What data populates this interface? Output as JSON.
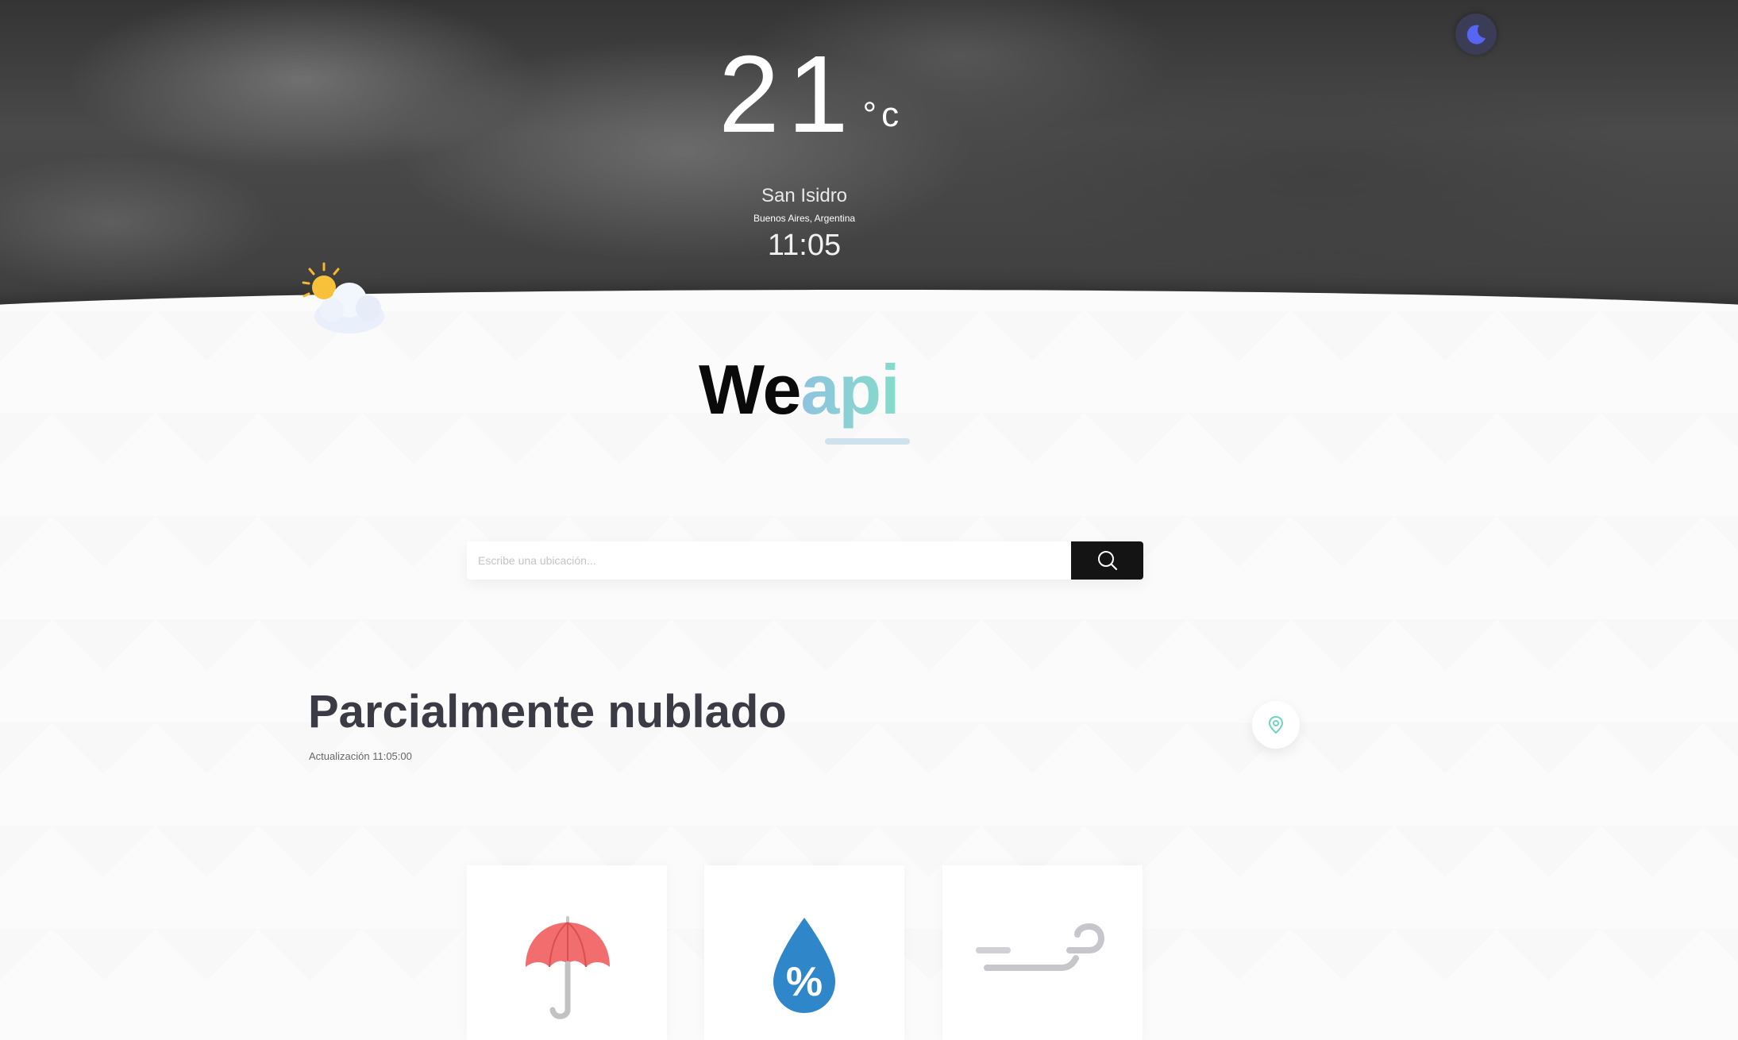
{
  "hero": {
    "temperature": "21",
    "unit": "°c",
    "city": "San Isidro",
    "region": "Buenos Aires, Argentina",
    "time": "11:05"
  },
  "theme_toggle": {
    "icon": "moon-icon",
    "accent": "#5865f2"
  },
  "logo": {
    "part1": "We",
    "part2": "api"
  },
  "search": {
    "placeholder": "Escribe una ubicación..."
  },
  "condition": {
    "title": "Parcialmente nublado",
    "updated": "Actualización 11:05:00"
  },
  "cards": [
    {
      "icon": "umbrella-icon"
    },
    {
      "icon": "humidity-drop-icon"
    },
    {
      "icon": "wind-icon"
    }
  ],
  "colors": {
    "hero_dark": "#3d3d3d",
    "logo_gradient_start": "#8fc3e0",
    "logo_gradient_end": "#85dcc9",
    "search_button": "#141414",
    "condition_text": "#3b3b45"
  }
}
